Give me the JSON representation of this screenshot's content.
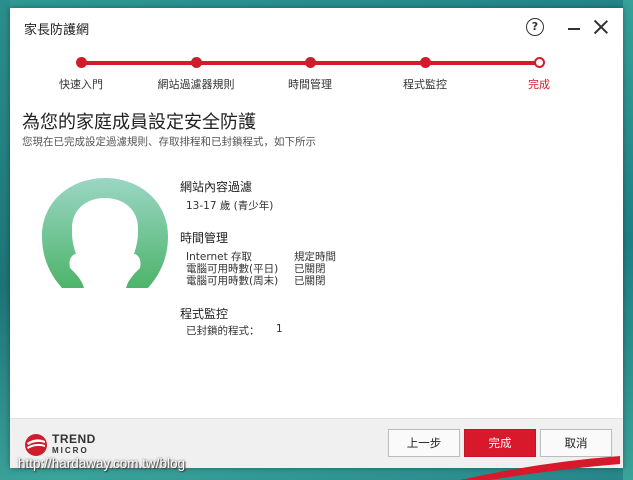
{
  "window": {
    "title": "家長防護網",
    "help_glyph": "?"
  },
  "stepper": {
    "steps": [
      {
        "label": "快速入門"
      },
      {
        "label": "網站過濾器規則"
      },
      {
        "label": "時間管理"
      },
      {
        "label": "程式監控"
      },
      {
        "label": "完成"
      }
    ],
    "active_index": 4
  },
  "main": {
    "headline": "為您的家庭成員設定安全防護",
    "subline": "您現在已完成設定過濾規則、存取排程和已封鎖程式，如下所示",
    "web_filter": {
      "title": "網站內容過濾",
      "value": "13-17 歲 (青少年)"
    },
    "time_mgmt": {
      "title": "時間管理",
      "rows": [
        {
          "label": "Internet 存取",
          "value": "規定時間"
        },
        {
          "label": "電腦可用時數(平日)",
          "value": "已關閉"
        },
        {
          "label": "電腦可用時數(周末)",
          "value": "已關閉"
        }
      ]
    },
    "program_ctrl": {
      "title": "程式監控",
      "label": "已封鎖的程式：",
      "value": "1"
    }
  },
  "footer": {
    "logo_line1": "TREND",
    "logo_line2": "MICRO",
    "back_label": "上一步",
    "finish_label": "完成",
    "cancel_label": "取消"
  },
  "watermark": "http://hardaway.com.tw/blog",
  "colors": {
    "accent": "#d11c2c",
    "avatar_green_top": "#8fd0be",
    "avatar_green_bottom": "#4fb86c"
  }
}
